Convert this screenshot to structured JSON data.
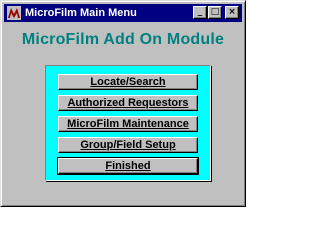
{
  "window": {
    "title": "MicroFilm Main Menu",
    "controls": {
      "minimize": "_",
      "maximize": "□",
      "close": "×"
    }
  },
  "main": {
    "heading": "MicroFilm Add On Module",
    "buttons": [
      {
        "label": "Locate/Search",
        "icon": ""
      },
      {
        "label": "Authorized Requestors"
      },
      {
        "label": "MicroFilm Maintenance"
      },
      {
        "label": "Group/Field Setup"
      },
      {
        "label": "Finished"
      }
    ]
  },
  "colors": {
    "title_bar": "#000080",
    "heading": "#008080",
    "panel": "#00ffff",
    "window": "#c0c0c0"
  },
  "icons": {
    "app": "app-logo-icon"
  }
}
